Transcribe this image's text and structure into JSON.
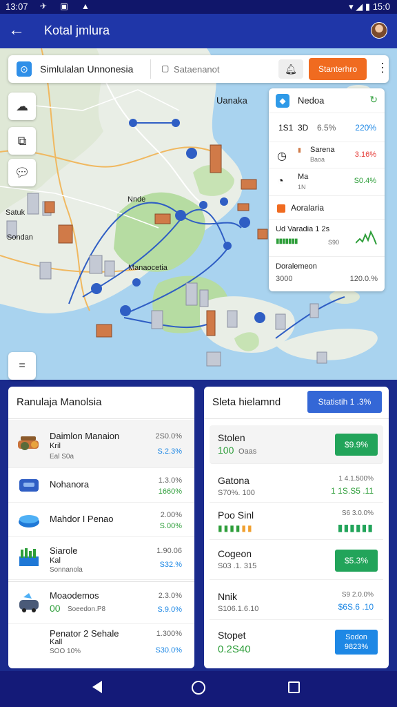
{
  "status_bar": {
    "time": "13:07",
    "right": "15:0"
  },
  "app_bar": {
    "title": "Kotal jmlura"
  },
  "search_bar": {
    "title": "Simlulalan Unnonesia",
    "placeholder": "Sataenanot",
    "cta_label": "Stanterhro"
  },
  "map": {
    "labels": {
      "top_right": "Uanaka",
      "center_top": "Nnde",
      "center": "Manaocetia",
      "left": "Satuk",
      "left_bottom": "Sondan"
    },
    "search_button_label": "="
  },
  "stats_panel": {
    "header": {
      "title": "Nedoa",
      "action": "↻"
    },
    "summary": {
      "a": "1S1",
      "b": "3D",
      "c": "6.5%",
      "d": "220%"
    },
    "rows": [
      {
        "name": "Sarena",
        "sub": "Baoa",
        "value": "3.16%",
        "color": "#e53935"
      },
      {
        "name": "Ma",
        "sub": "1N",
        "value": "S0.4%",
        "color": "#2e9e3a"
      }
    ],
    "section_title": "Aoralaria",
    "sparkline_label": "Ud Varadia 1 2s",
    "sparkline_value": "S90",
    "footer_title": "Doralemeon",
    "footer_left": "3000",
    "footer_right": "120.0.%"
  },
  "left_panel": {
    "title": "Ranulaja Manolsia",
    "items": [
      {
        "name": "Daimlon Manaion",
        "name2": "Kril",
        "sub": "Eal S0a",
        "val1": "2S0.0%",
        "val2": "S.2.3%",
        "color": "#1e88e5"
      },
      {
        "name": "Nohanora",
        "name2": "",
        "sub": "",
        "val1": "1.3.0%",
        "val2": "1660%",
        "color": "#2e9e3a"
      },
      {
        "name": "Mahdor I Penao",
        "name2": "",
        "sub": "",
        "val1": "2.00%",
        "val2": "S.00%",
        "color": "#2e9e3a"
      },
      {
        "name": "Siarole",
        "name2": "Kal",
        "sub": "Sonnanola",
        "val1": "1.90.06",
        "val2": "S32.%",
        "color": "#1e88e5"
      },
      {
        "name": "Moaodemos",
        "name2": "00",
        "sub": "Soeedon.P8",
        "val1": "2.3.0%",
        "val2": "S.9.0%",
        "color": "#1e88e5"
      },
      {
        "name": "Penator 2 Sehale",
        "name2": "Kall",
        "sub": "SOO 10%",
        "val1": "1.300%",
        "val2": "S30.0%",
        "color": "#1e88e5"
      }
    ]
  },
  "right_panel": {
    "title": "Sleta hielamnd",
    "button_label": "Statistih 1 .3%",
    "items": [
      {
        "name": "Stolen",
        "sub": "100",
        "sub2": "Oaas",
        "badge": "$9.9%",
        "badge_color": "#22a45a"
      },
      {
        "name": "Gatona",
        "sub": "S70%. 100",
        "val1": "1 4.1.500%",
        "val2": "1 1S.S5 .11",
        "color": "#2e9e3a"
      },
      {
        "name": "Poo Sinl",
        "sub": "",
        "val1": "S6 3.0.0%",
        "val2": "",
        "color": "#2e9e3a"
      },
      {
        "name": "Cogeon",
        "sub": "S03 .1. 315",
        "badge": "$5.3%",
        "badge_color": "#22a45a"
      },
      {
        "name": "Nnik",
        "sub": "S106.1.6.10",
        "val1": "S9 2.0.0%",
        "val2": "$6S.6 .10",
        "color": "#1e88e5"
      },
      {
        "name": "Stopet",
        "sub": "0.2S40",
        "badge": "Sodon 9823%",
        "badge_color": "#1e88e5"
      }
    ]
  }
}
